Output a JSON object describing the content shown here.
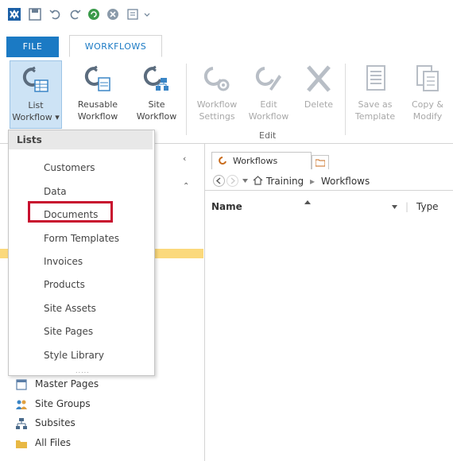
{
  "ribbon": {
    "file_tab": "FILE",
    "workflows_tab": "WORKFLOWS",
    "buttons": [
      {
        "line1": "List",
        "line2": "Workflow ▾",
        "icon": "list-workflow-icon"
      },
      {
        "line1": "Reusable",
        "line2": "Workflow",
        "icon": "reusable-workflow-icon"
      },
      {
        "line1": "Site",
        "line2": "Workflow",
        "icon": "site-workflow-icon"
      },
      {
        "line1": "Workflow",
        "line2": "Settings",
        "icon": "workflow-settings-icon"
      },
      {
        "line1": "Edit",
        "line2": "Workflow",
        "icon": "edit-workflow-icon"
      },
      {
        "line1": "Delete",
        "line2": "",
        "icon": "delete-icon"
      },
      {
        "line1": "Save as",
        "line2": "Template",
        "icon": "save-as-template-icon"
      },
      {
        "line1": "Copy &",
        "line2": "Modify",
        "icon": "copy-modify-icon"
      }
    ],
    "edit_group_label": "Edit"
  },
  "menu": {
    "header": "Lists",
    "items": [
      "Customers",
      "Data",
      "Documents",
      "Form Templates",
      "Invoices",
      "Products",
      "Site Assets",
      "Site Pages",
      "Style Library"
    ],
    "highlighted_item": "Documents"
  },
  "nav": {
    "collapse_glyph": "‹",
    "up_glyph": "⌃",
    "bottom_items": [
      {
        "label": "Master Pages",
        "icon": "master-pages-icon"
      },
      {
        "label": "Site Groups",
        "icon": "site-groups-icon"
      },
      {
        "label": "Subsites",
        "icon": "subsites-icon"
      },
      {
        "label": "All Files",
        "icon": "all-files-icon"
      }
    ]
  },
  "content": {
    "tab_label": "Workflows",
    "breadcrumb": {
      "root": "Training",
      "separator": "▸",
      "current": "Workflows"
    },
    "columns": {
      "name": "Name",
      "type": "Type"
    }
  },
  "colors": {
    "accent": "#1b7ac4",
    "highlight_box": "#c8102e",
    "nav_highlight": "#fbd97c"
  }
}
